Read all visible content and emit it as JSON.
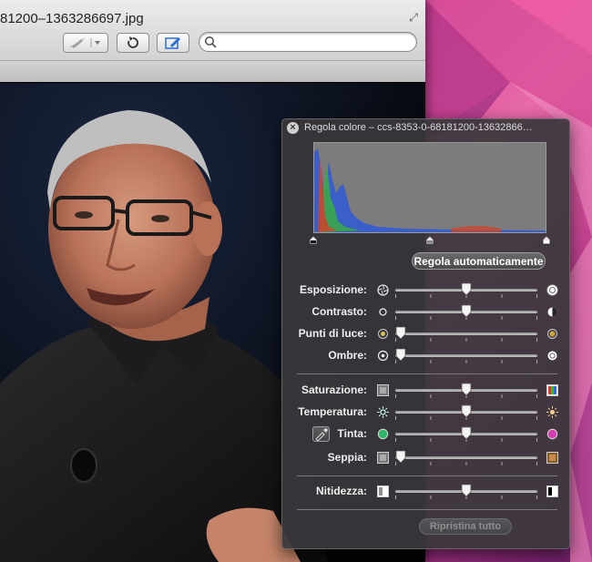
{
  "window": {
    "title": "81200–1363286697.jpg",
    "search_placeholder": ""
  },
  "panel": {
    "title": "Regola colore – ccs-8353-0-68181200-13632866…",
    "auto_button": "Regola automaticamente",
    "reset_button": "Ripristina tutto",
    "levels": {
      "black": 0.0,
      "mid": 0.5,
      "white": 1.0
    },
    "sliders": [
      {
        "key": "esposizione",
        "label": "Esposizione:",
        "value": 0.5,
        "left_icon": "aperture-icon",
        "right_icon": "sun-circle-icon"
      },
      {
        "key": "contrasto",
        "label": "Contrasto:",
        "value": 0.5,
        "left_icon": "circle-small-icon",
        "right_icon": "half-circle-icon"
      },
      {
        "key": "punti_luce",
        "label": "Punti di luce:",
        "value": 0.0,
        "left_icon": "highlight-dim-icon",
        "right_icon": "highlight-bright-icon"
      },
      {
        "key": "ombre",
        "label": "Ombre:",
        "value": 0.0,
        "left_icon": "shadow-dot-icon",
        "right_icon": "shadow-light-icon"
      },
      {
        "key": "saturazione",
        "label": "Saturazione:",
        "value": 0.5,
        "left_icon": "gray-swatch-icon",
        "right_icon": "color-swatch-icon"
      },
      {
        "key": "temperatura",
        "label": "Temperatura:",
        "value": 0.5,
        "left_icon": "cool-sun-icon",
        "right_icon": "warm-sun-icon"
      },
      {
        "key": "tinta",
        "label": "Tinta:",
        "value": 0.5,
        "left_icon": "green-dot-icon",
        "right_icon": "magenta-dot-icon"
      },
      {
        "key": "seppia",
        "label": "Seppia:",
        "value": 0.0,
        "left_icon": "gray-swatch-icon",
        "right_icon": "sepia-swatch-icon"
      },
      {
        "key": "nitidezza",
        "label": "Nitidezza:",
        "value": 0.5,
        "left_icon": "blur-icon",
        "right_icon": "sharp-icon"
      }
    ]
  },
  "colors": {
    "hist_blue": "#3a5fc8",
    "hist_green": "#3aa84a",
    "hist_red": "#c8482e",
    "panel_bg": "#3a383c"
  }
}
